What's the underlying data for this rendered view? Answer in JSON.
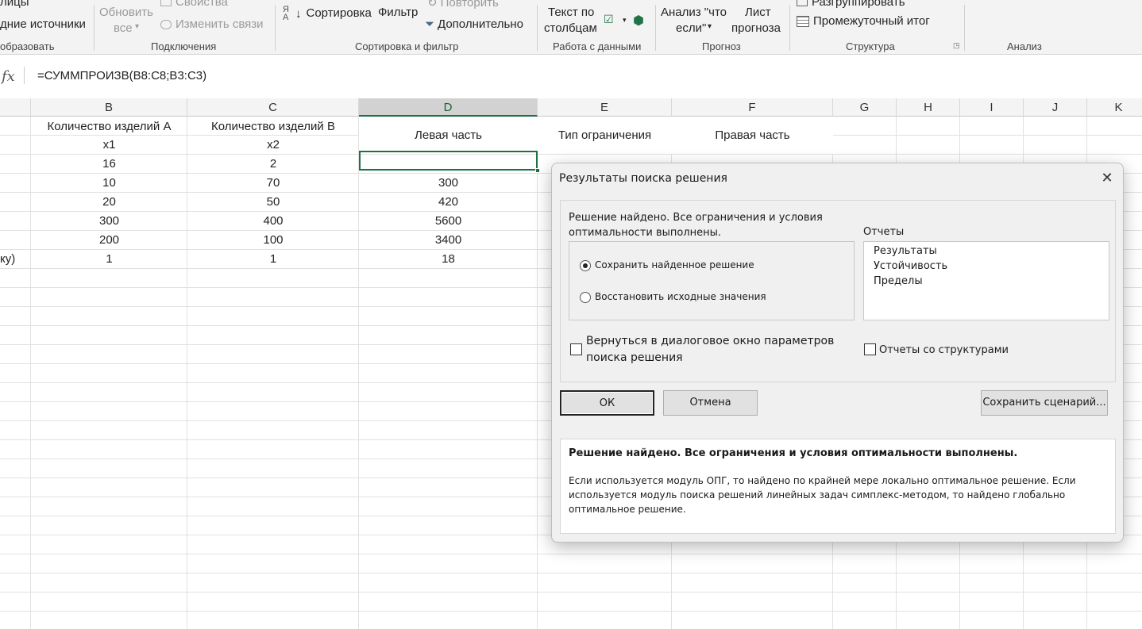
{
  "ribbon": {
    "items": {
      "tables_tail": "лицы",
      "recent_sources": "дние источники",
      "refresh_all": [
        "Обновить",
        "все"
      ],
      "properties": "Свойства",
      "edit_links": "Изменить связи",
      "sort": "Сортировка",
      "filter": "Фильтр",
      "reapply": "Повторить",
      "advanced": "Дополнительно",
      "text_to_columns": [
        "Текст по",
        "столбцам"
      ],
      "what_if": [
        "Анализ \"что",
        "если\""
      ],
      "forecast_sheet": [
        "Лист",
        "прогноза"
      ],
      "ungroup": "Разгруппировать",
      "subtotal": "Промежуточный итог"
    },
    "groups": {
      "transform": "образовать",
      "connections": "Подключения",
      "sort_filter": "Сортировка и фильтр",
      "data_tools": "Работа с данными",
      "forecast": "Прогноз",
      "outline": "Структура",
      "analysis": "Анализ"
    }
  },
  "formula_bar": {
    "fx": "fx",
    "formula": "=СУММПРОИЗВ(B8:C8;B3:C3)"
  },
  "sheet": {
    "columns": [
      "B",
      "C",
      "D",
      "E",
      "F",
      "G",
      "H",
      "I",
      "J",
      "K"
    ],
    "header_row": {
      "b": "Количество изделий А",
      "c": "Количество изделий В",
      "d": "Левая часть",
      "e": "Тип ограничения",
      "f": "Правая часть"
    },
    "var_row": {
      "b": "x1",
      "c": "x2"
    },
    "rows": [
      {
        "b": "16",
        "c": "2",
        "d": ""
      },
      {
        "b": "10",
        "c": "70",
        "d": "300"
      },
      {
        "b": "20",
        "c": "50",
        "d": "420"
      },
      {
        "b": "300",
        "c": "400",
        "d": "5600"
      },
      {
        "b": "200",
        "c": "100",
        "d": "3400"
      },
      {
        "a": "ку)",
        "b": "1",
        "c": "1",
        "d": "18"
      }
    ]
  },
  "dialog": {
    "title": "Результаты поиска решения",
    "status": "Решение найдено. Все ограничения и условия оптимальности выполнены.",
    "keep_solution": "Сохранить найденное решение",
    "restore_values": "Восстановить исходные значения",
    "reports_label": "Отчеты",
    "reports": [
      "Результаты",
      "Устойчивость",
      "Пределы"
    ],
    "return_to_params": "Вернуться в диалоговое окно параметров поиска решения",
    "outline_reports": "Отчеты со структурами",
    "ok": "ОК",
    "cancel": "Отмена",
    "save_scenario": "Сохранить сценарий...",
    "info_title": "Решение найдено. Все ограничения и условия оптимальности выполнены.",
    "info_body": "Если используется модуль ОПГ, то найдено по крайней мере локально оптимальное решение. Если используется модуль поиска решений линейных задач симплекс-методом, то найдено глобально оптимальное решение."
  }
}
